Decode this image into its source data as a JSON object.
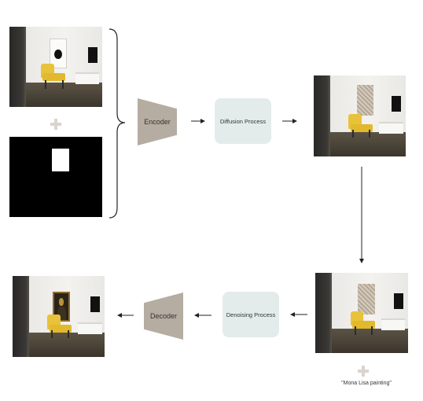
{
  "nodes": {
    "encoder": "Encoder",
    "diffusion": "Diffusion Process",
    "denoising": "Denoising  Process",
    "decoder": "Decoder"
  },
  "prompt_text": "\"Mona Lisa painting\"",
  "colors": {
    "process_box": "#e3eceb",
    "codec_shape": "#b5aca2",
    "plus_sign": "#d9d4cf",
    "mask": "#000000",
    "chair": "#e8c23a"
  }
}
